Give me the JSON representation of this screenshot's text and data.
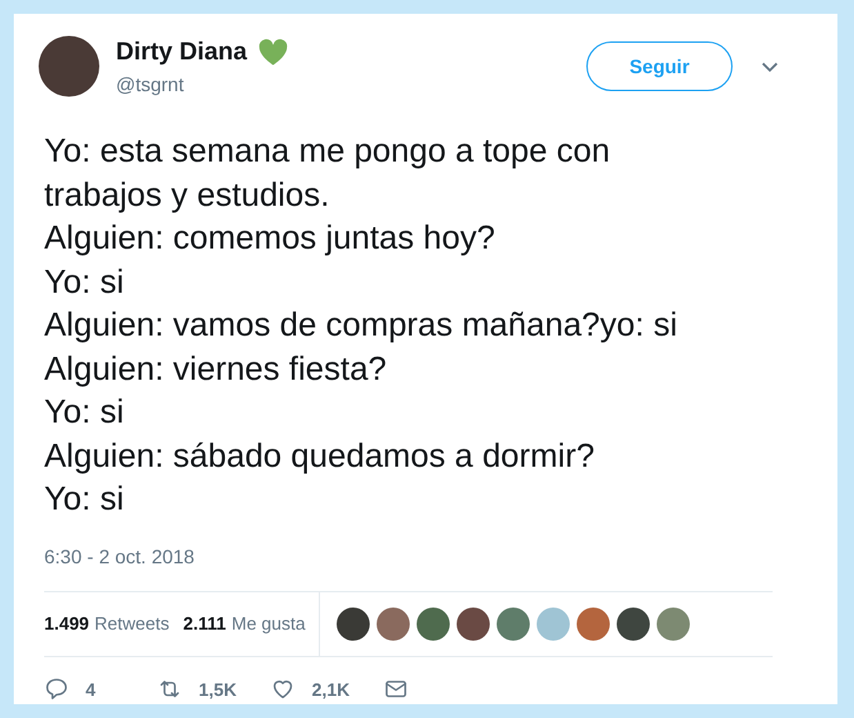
{
  "author": {
    "name": "Dirty Diana",
    "handle": "@tsgrnt"
  },
  "follow_button": "Seguir",
  "tweet_lines": [
    "Yo: esta semana me pongo a tope con",
    "trabajos y estudios.",
    "Alguien: comemos juntas hoy?",
    "Yo: si",
    "Alguien: vamos de compras mañana?yo: si",
    "Alguien: viernes fiesta?",
    "Yo: si",
    "Alguien: sábado quedamos a dormir?",
    "Yo: si"
  ],
  "timestamp": "6:30 - 2 oct. 2018",
  "stats": [
    {
      "count": "1.499",
      "label": "Retweets"
    },
    {
      "count": "2.111",
      "label": "Me gusta"
    }
  ],
  "liker_avatars": [
    {
      "color": "#3a3a36"
    },
    {
      "color": "#8a6a5e"
    },
    {
      "color": "#4f6b4e"
    },
    {
      "color": "#6a4a44"
    },
    {
      "color": "#5f7d6a"
    },
    {
      "color": "#9fc4d4"
    },
    {
      "color": "#b4653e"
    },
    {
      "color": "#3f4640"
    },
    {
      "color": "#7d8a72"
    }
  ],
  "actions": [
    {
      "kind": "reply",
      "count": "4"
    },
    {
      "kind": "retweet",
      "count": "1,5K"
    },
    {
      "kind": "like",
      "count": "2,1K"
    },
    {
      "kind": "message"
    }
  ]
}
